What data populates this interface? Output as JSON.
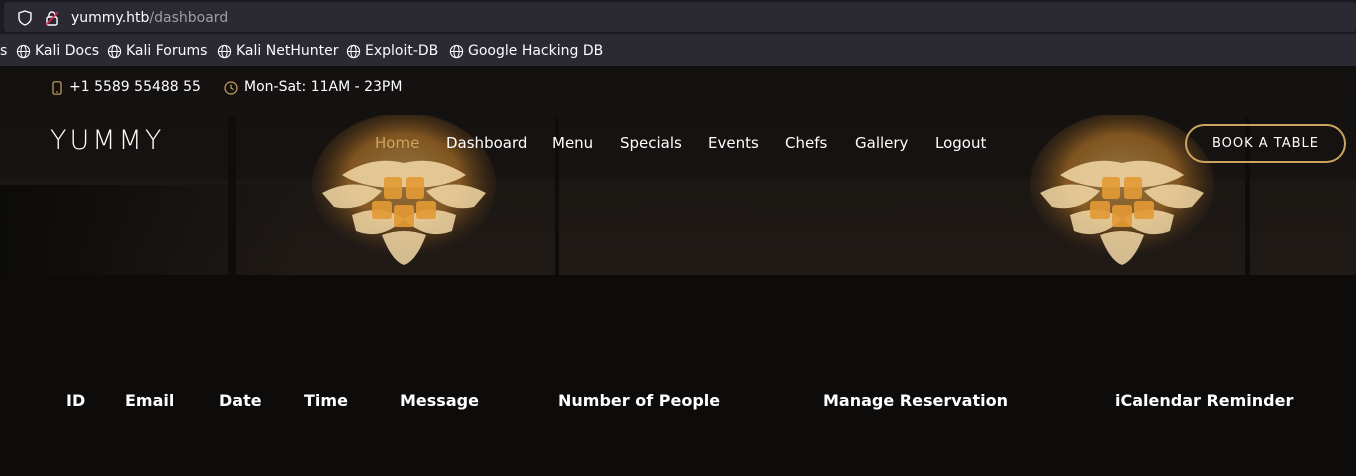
{
  "browser": {
    "url_host": "yummy.htb",
    "url_path": "/dashboard",
    "bookmarks_cut_label": "s",
    "bookmarks": [
      {
        "label": "Kali Docs"
      },
      {
        "label": "Kali Forums"
      },
      {
        "label": "Kali NetHunter"
      },
      {
        "label": "Exploit-DB"
      },
      {
        "label": "Google Hacking DB"
      }
    ]
  },
  "topbar": {
    "phone": "+1 5589 55488 55",
    "hours": "Mon-Sat: 11AM - 23PM"
  },
  "header": {
    "logo": "YUMMY",
    "nav": [
      {
        "label": "Home",
        "active": true
      },
      {
        "label": "Dashboard"
      },
      {
        "label": "Menu"
      },
      {
        "label": "Specials"
      },
      {
        "label": "Events"
      },
      {
        "label": "Chefs"
      },
      {
        "label": "Gallery"
      },
      {
        "label": "Logout"
      }
    ],
    "book_button": "BOOK A TABLE"
  },
  "table": {
    "columns": [
      "ID",
      "Email",
      "Date",
      "Time",
      "Message",
      "Number of People",
      "Manage Reservation",
      "iCalendar Reminder"
    ],
    "rows": []
  },
  "colors": {
    "accent": "#cda45e",
    "page_bg": "#0d0c0b",
    "chrome_bg": "#2b2a33"
  }
}
